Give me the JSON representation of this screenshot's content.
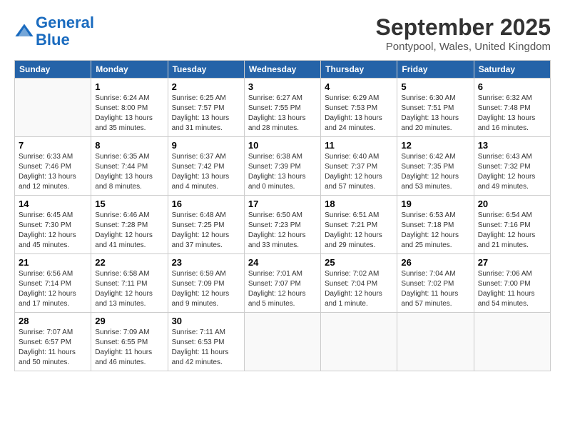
{
  "header": {
    "logo_line1": "General",
    "logo_line2": "Blue",
    "month": "September 2025",
    "location": "Pontypool, Wales, United Kingdom"
  },
  "weekdays": [
    "Sunday",
    "Monday",
    "Tuesday",
    "Wednesday",
    "Thursday",
    "Friday",
    "Saturday"
  ],
  "weeks": [
    [
      {
        "day": "",
        "info": ""
      },
      {
        "day": "1",
        "info": "Sunrise: 6:24 AM\nSunset: 8:00 PM\nDaylight: 13 hours\nand 35 minutes."
      },
      {
        "day": "2",
        "info": "Sunrise: 6:25 AM\nSunset: 7:57 PM\nDaylight: 13 hours\nand 31 minutes."
      },
      {
        "day": "3",
        "info": "Sunrise: 6:27 AM\nSunset: 7:55 PM\nDaylight: 13 hours\nand 28 minutes."
      },
      {
        "day": "4",
        "info": "Sunrise: 6:29 AM\nSunset: 7:53 PM\nDaylight: 13 hours\nand 24 minutes."
      },
      {
        "day": "5",
        "info": "Sunrise: 6:30 AM\nSunset: 7:51 PM\nDaylight: 13 hours\nand 20 minutes."
      },
      {
        "day": "6",
        "info": "Sunrise: 6:32 AM\nSunset: 7:48 PM\nDaylight: 13 hours\nand 16 minutes."
      }
    ],
    [
      {
        "day": "7",
        "info": "Sunrise: 6:33 AM\nSunset: 7:46 PM\nDaylight: 13 hours\nand 12 minutes."
      },
      {
        "day": "8",
        "info": "Sunrise: 6:35 AM\nSunset: 7:44 PM\nDaylight: 13 hours\nand 8 minutes."
      },
      {
        "day": "9",
        "info": "Sunrise: 6:37 AM\nSunset: 7:42 PM\nDaylight: 13 hours\nand 4 minutes."
      },
      {
        "day": "10",
        "info": "Sunrise: 6:38 AM\nSunset: 7:39 PM\nDaylight: 13 hours\nand 0 minutes."
      },
      {
        "day": "11",
        "info": "Sunrise: 6:40 AM\nSunset: 7:37 PM\nDaylight: 12 hours\nand 57 minutes."
      },
      {
        "day": "12",
        "info": "Sunrise: 6:42 AM\nSunset: 7:35 PM\nDaylight: 12 hours\nand 53 minutes."
      },
      {
        "day": "13",
        "info": "Sunrise: 6:43 AM\nSunset: 7:32 PM\nDaylight: 12 hours\nand 49 minutes."
      }
    ],
    [
      {
        "day": "14",
        "info": "Sunrise: 6:45 AM\nSunset: 7:30 PM\nDaylight: 12 hours\nand 45 minutes."
      },
      {
        "day": "15",
        "info": "Sunrise: 6:46 AM\nSunset: 7:28 PM\nDaylight: 12 hours\nand 41 minutes."
      },
      {
        "day": "16",
        "info": "Sunrise: 6:48 AM\nSunset: 7:25 PM\nDaylight: 12 hours\nand 37 minutes."
      },
      {
        "day": "17",
        "info": "Sunrise: 6:50 AM\nSunset: 7:23 PM\nDaylight: 12 hours\nand 33 minutes."
      },
      {
        "day": "18",
        "info": "Sunrise: 6:51 AM\nSunset: 7:21 PM\nDaylight: 12 hours\nand 29 minutes."
      },
      {
        "day": "19",
        "info": "Sunrise: 6:53 AM\nSunset: 7:18 PM\nDaylight: 12 hours\nand 25 minutes."
      },
      {
        "day": "20",
        "info": "Sunrise: 6:54 AM\nSunset: 7:16 PM\nDaylight: 12 hours\nand 21 minutes."
      }
    ],
    [
      {
        "day": "21",
        "info": "Sunrise: 6:56 AM\nSunset: 7:14 PM\nDaylight: 12 hours\nand 17 minutes."
      },
      {
        "day": "22",
        "info": "Sunrise: 6:58 AM\nSunset: 7:11 PM\nDaylight: 12 hours\nand 13 minutes."
      },
      {
        "day": "23",
        "info": "Sunrise: 6:59 AM\nSunset: 7:09 PM\nDaylight: 12 hours\nand 9 minutes."
      },
      {
        "day": "24",
        "info": "Sunrise: 7:01 AM\nSunset: 7:07 PM\nDaylight: 12 hours\nand 5 minutes."
      },
      {
        "day": "25",
        "info": "Sunrise: 7:02 AM\nSunset: 7:04 PM\nDaylight: 12 hours\nand 1 minute."
      },
      {
        "day": "26",
        "info": "Sunrise: 7:04 AM\nSunset: 7:02 PM\nDaylight: 11 hours\nand 57 minutes."
      },
      {
        "day": "27",
        "info": "Sunrise: 7:06 AM\nSunset: 7:00 PM\nDaylight: 11 hours\nand 54 minutes."
      }
    ],
    [
      {
        "day": "28",
        "info": "Sunrise: 7:07 AM\nSunset: 6:57 PM\nDaylight: 11 hours\nand 50 minutes."
      },
      {
        "day": "29",
        "info": "Sunrise: 7:09 AM\nSunset: 6:55 PM\nDaylight: 11 hours\nand 46 minutes."
      },
      {
        "day": "30",
        "info": "Sunrise: 7:11 AM\nSunset: 6:53 PM\nDaylight: 11 hours\nand 42 minutes."
      },
      {
        "day": "",
        "info": ""
      },
      {
        "day": "",
        "info": ""
      },
      {
        "day": "",
        "info": ""
      },
      {
        "day": "",
        "info": ""
      }
    ]
  ]
}
